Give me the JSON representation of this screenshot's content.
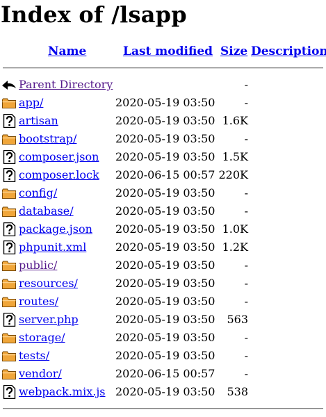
{
  "title": "Index of /lsapp",
  "columns": {
    "name": "Name",
    "last_modified": "Last modified",
    "size": "Size",
    "description": "Description"
  },
  "entries": [
    {
      "name": "Parent Directory",
      "date": "",
      "size": "-",
      "type": "parent",
      "visited": true
    },
    {
      "name": "app/",
      "date": "2020-05-19 03:50",
      "size": "-",
      "type": "folder",
      "visited": false
    },
    {
      "name": "artisan",
      "date": "2020-05-19 03:50",
      "size": "1.6K",
      "type": "file",
      "visited": false
    },
    {
      "name": "bootstrap/",
      "date": "2020-05-19 03:50",
      "size": "-",
      "type": "folder",
      "visited": false
    },
    {
      "name": "composer.json",
      "date": "2020-05-19 03:50",
      "size": "1.5K",
      "type": "file",
      "visited": false
    },
    {
      "name": "composer.lock",
      "date": "2020-06-15 00:57",
      "size": "220K",
      "type": "file",
      "visited": false
    },
    {
      "name": "config/",
      "date": "2020-05-19 03:50",
      "size": "-",
      "type": "folder",
      "visited": false
    },
    {
      "name": "database/",
      "date": "2020-05-19 03:50",
      "size": "-",
      "type": "folder",
      "visited": false
    },
    {
      "name": "package.json",
      "date": "2020-05-19 03:50",
      "size": "1.0K",
      "type": "file",
      "visited": false
    },
    {
      "name": "phpunit.xml",
      "date": "2020-05-19 03:50",
      "size": "1.2K",
      "type": "file",
      "visited": false
    },
    {
      "name": "public/",
      "date": "2020-05-19 03:50",
      "size": "-",
      "type": "folder",
      "visited": true
    },
    {
      "name": "resources/",
      "date": "2020-05-19 03:50",
      "size": "-",
      "type": "folder",
      "visited": false
    },
    {
      "name": "routes/",
      "date": "2020-05-19 03:50",
      "size": "-",
      "type": "folder",
      "visited": false
    },
    {
      "name": "server.php",
      "date": "2020-05-19 03:50",
      "size": "563",
      "type": "file",
      "visited": false
    },
    {
      "name": "storage/",
      "date": "2020-05-19 03:50",
      "size": "-",
      "type": "folder",
      "visited": false
    },
    {
      "name": "tests/",
      "date": "2020-05-19 03:50",
      "size": "-",
      "type": "folder",
      "visited": false
    },
    {
      "name": "vendor/",
      "date": "2020-06-15 00:57",
      "size": "-",
      "type": "folder",
      "visited": false
    },
    {
      "name": "webpack.mix.js",
      "date": "2020-05-19 03:50",
      "size": "538",
      "type": "file",
      "visited": false
    }
  ]
}
